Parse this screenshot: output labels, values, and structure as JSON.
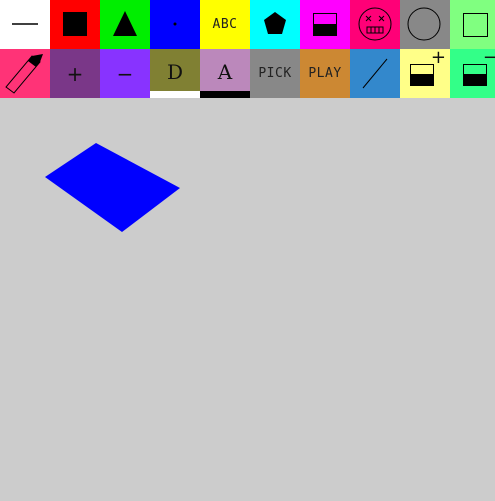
{
  "toolbar": {
    "row1": [
      {
        "name": "line-tool",
        "color": "#ffffff"
      },
      {
        "name": "filled-square-tool",
        "color": "#ff0000"
      },
      {
        "name": "triangle-tool",
        "color": "#00ee00"
      },
      {
        "name": "point-tool",
        "color": "#0000ff"
      },
      {
        "name": "text-tool",
        "color": "#ffff00",
        "label": "ABC"
      },
      {
        "name": "pentagon-tool",
        "color": "#00ffff"
      },
      {
        "name": "fill-tool",
        "color": "#ff00ff"
      },
      {
        "name": "clear-tool",
        "color": "#ff0077"
      },
      {
        "name": "circle-tool",
        "color": "#888888"
      },
      {
        "name": "rectangle-outline-tool",
        "color": "#80ff80"
      }
    ],
    "row2": [
      {
        "name": "pencil-tool",
        "color": "#ff3377"
      },
      {
        "name": "zoom-in-tool",
        "color": "#7a3788",
        "label": "+"
      },
      {
        "name": "zoom-out-tool",
        "color": "#8833ff",
        "label": "−"
      },
      {
        "name": "draw-mode-button",
        "color": "#808033",
        "label": "D",
        "underline_color": "#ffffff"
      },
      {
        "name": "font-button",
        "color": "#bb88bb",
        "label": "A",
        "underline_color": "#000000"
      },
      {
        "name": "pick-button",
        "color": "#888888",
        "label": "PICK"
      },
      {
        "name": "play-button",
        "color": "#cc8833",
        "label": "PLAY"
      },
      {
        "name": "stroke-tool",
        "color": "#3388cc"
      },
      {
        "name": "increase-size-button",
        "color": "#ffff88",
        "label": "+"
      },
      {
        "name": "decrease-size-button",
        "color": "#33ff88",
        "label": "−"
      }
    ]
  },
  "canvas": {
    "background": "#cccccc",
    "shape_color": "#0000ff"
  }
}
